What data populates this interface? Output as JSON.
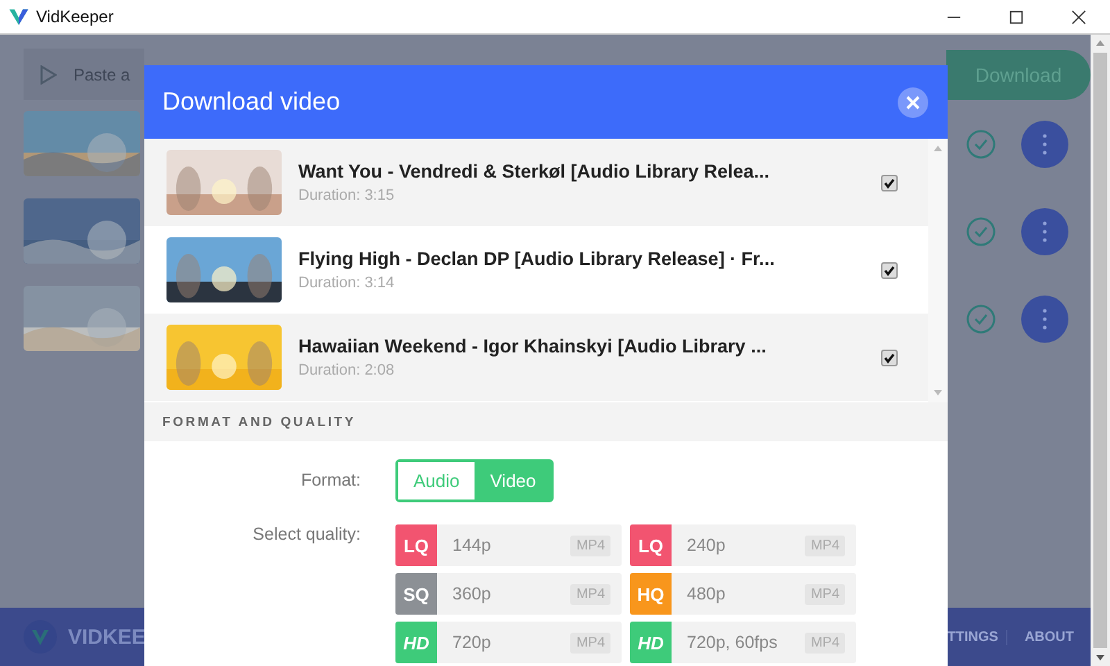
{
  "window": {
    "title": "VidKeeper"
  },
  "app": {
    "url_placeholder": "Paste a",
    "download_button": "Download",
    "videos": [
      {
        "kind": "picture",
        "done": true
      },
      {
        "kind": "picture",
        "done": true
      },
      {
        "kind": "picture",
        "done": true
      }
    ],
    "footer": {
      "brand": "VIDKEE",
      "nav": [
        "TTINGS",
        "ABOUT"
      ]
    }
  },
  "dialog": {
    "title": "Download video",
    "items": [
      {
        "title": "Want You - Vendredi & Sterkøl [Audio Library Relea...",
        "duration": "Duration: 3:15",
        "checked": true
      },
      {
        "title": "Flying High - Declan DP [Audio Library Release] · Fr...",
        "duration": "Duration: 3:14",
        "checked": true
      },
      {
        "title": "Hawaiian Weekend - Igor Khainskyi [Audio Library ...",
        "duration": "Duration: 2:08",
        "checked": true
      }
    ],
    "section": "FORMAT AND QUALITY",
    "format_label": "Format:",
    "formats": [
      {
        "label": "Audio",
        "selected": false
      },
      {
        "label": "Video",
        "selected": true
      }
    ],
    "quality_label": "Select quality:",
    "qualities": [
      {
        "badge": "LQ",
        "color": "#f25470",
        "resolution": "144p",
        "container": "MP4"
      },
      {
        "badge": "LQ",
        "color": "#f25470",
        "resolution": "240p",
        "container": "MP4"
      },
      {
        "badge": "SQ",
        "color": "#8c9095",
        "resolution": "360p",
        "container": "MP4"
      },
      {
        "badge": "HQ",
        "color": "#f8961c",
        "resolution": "480p",
        "container": "MP4"
      },
      {
        "badge": "HD",
        "color": "#3ecb7a",
        "resolution": "720p",
        "container": "MP4"
      },
      {
        "badge": "HD",
        "color": "#3ecb7a",
        "resolution": "720p, 60fps",
        "container": "MP4"
      }
    ]
  }
}
